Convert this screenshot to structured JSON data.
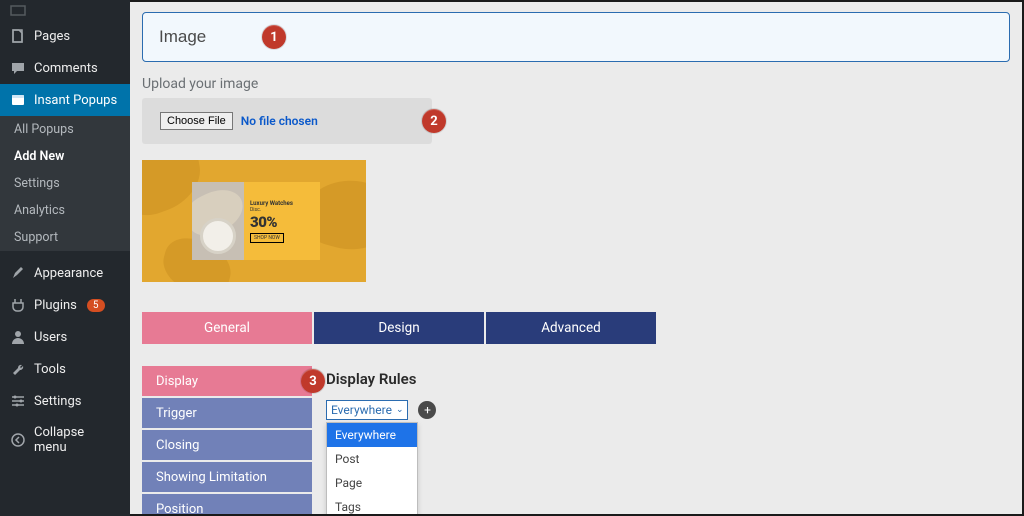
{
  "sidebar": {
    "items": [
      {
        "label": "Pages"
      },
      {
        "label": "Comments"
      },
      {
        "label": "Insant Popups"
      },
      {
        "label": "Appearance"
      },
      {
        "label": "Plugins",
        "badge": "5"
      },
      {
        "label": "Users"
      },
      {
        "label": "Tools"
      },
      {
        "label": "Settings"
      },
      {
        "label": "Collapse menu"
      }
    ],
    "sub": [
      {
        "label": "All Popups"
      },
      {
        "label": "Add New"
      },
      {
        "label": "Settings"
      },
      {
        "label": "Analytics"
      },
      {
        "label": "Support"
      }
    ]
  },
  "title": {
    "value": "Image"
  },
  "upload": {
    "section_label": "Upload your image",
    "button": "Choose File",
    "status": "No file chosen"
  },
  "preview_card": {
    "line1": "Luxury Watches",
    "line2": "Disc.",
    "line3": "30%",
    "line4": "SHOP NOW"
  },
  "tabs": [
    {
      "label": "General"
    },
    {
      "label": "Design"
    },
    {
      "label": "Advanced"
    }
  ],
  "side_tabs": [
    {
      "label": "Display"
    },
    {
      "label": "Trigger"
    },
    {
      "label": "Closing"
    },
    {
      "label": "Showing Limitation"
    },
    {
      "label": "Position"
    }
  ],
  "rules": {
    "title": "Display Rules",
    "selected": "Everywhere",
    "options": [
      "Everywhere",
      "Post",
      "Page",
      "Tags"
    ]
  },
  "annotations": {
    "a1": "1",
    "a2": "2",
    "a3": "3"
  }
}
